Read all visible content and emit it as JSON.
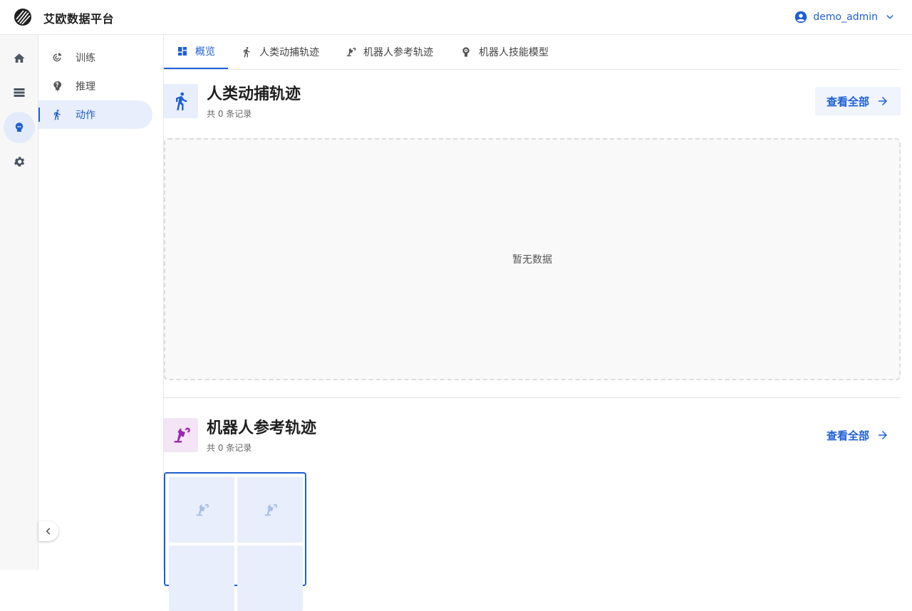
{
  "app": {
    "title": "艾欧数据平台"
  },
  "user": {
    "name": "demo_admin"
  },
  "rail": {
    "items": [
      {
        "icon": "home-icon",
        "active": false
      },
      {
        "icon": "storage-icon",
        "active": false
      },
      {
        "icon": "robot-head-icon",
        "active": true
      },
      {
        "icon": "gear-icon",
        "active": false
      }
    ]
  },
  "subnav": {
    "items": [
      {
        "label": "训练",
        "icon": "training-icon"
      },
      {
        "label": "推理",
        "icon": "inference-icon"
      },
      {
        "label": "动作",
        "icon": "running-person-icon",
        "active": true
      }
    ]
  },
  "tabs": [
    {
      "label": "概览",
      "icon": "dashboard-icon",
      "active": true
    },
    {
      "label": "人类动捕轨迹",
      "icon": "running-person-icon"
    },
    {
      "label": "机器人参考轨迹",
      "icon": "robot-arm-icon"
    },
    {
      "label": "机器人技能模型",
      "icon": "skill-model-icon"
    }
  ],
  "sections": {
    "human": {
      "title": "人类动捕轨迹",
      "count": "共 0 条记录",
      "view_all": "查看全部",
      "empty": "暂无数据",
      "icon_color": "#1d5fd6"
    },
    "robot": {
      "title": "机器人参考轨迹",
      "count": "共 0 条记录",
      "view_all": "查看全部",
      "icon_color": "#9c27b0"
    }
  },
  "colors": {
    "accent": "#1d5fd6",
    "robot_accent": "#9c27b0"
  }
}
